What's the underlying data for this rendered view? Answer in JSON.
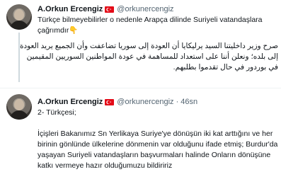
{
  "tweet1": {
    "author_name": "A.Orkun Ercengiz",
    "handle": "@orkunercengiz",
    "time": "46sn",
    "flag_icon": "turkey-flag-icon",
    "lines": [
      "Türkçe bilmeyebilirler o nedenle Arapça dilinde Suriyeli vatandaşlara",
      "çağrımdır👇"
    ],
    "arabic_lines": [
      "صرح وزير داخليتنا السيد يرليكايا أن العودة إلى سوريا تضاعفت وأن الجميع يريد العودة",
      "إلى بلده؛ ونعلن أننا على استعداد للمساهمة في عودة المواطنين السوريين المقيمين",
      "في بوردور في حال تقدموا بطلبهم."
    ]
  },
  "tweet2": {
    "author_name": "A.Orkun Ercengiz",
    "handle": "@orkunercengiz",
    "time": "46sn",
    "flag_icon": "turkey-flag-icon",
    "lines": [
      "2- Türkçesi;",
      "",
      "İçişleri Bakanımız  Sn Yerlikaya Suriye'ye dönüşün iki kat arttığını ve her",
      "birinin gönlünde ülkelerine dönmenin var olduğunu ifade etmiş; Burdur'da",
      "yaşayan Suriyeli vatandaşların başvurmaları halinde Onların  dönüşüne",
      "katkı vermeye  hazır olduğumuzu bildiririz"
    ]
  }
}
